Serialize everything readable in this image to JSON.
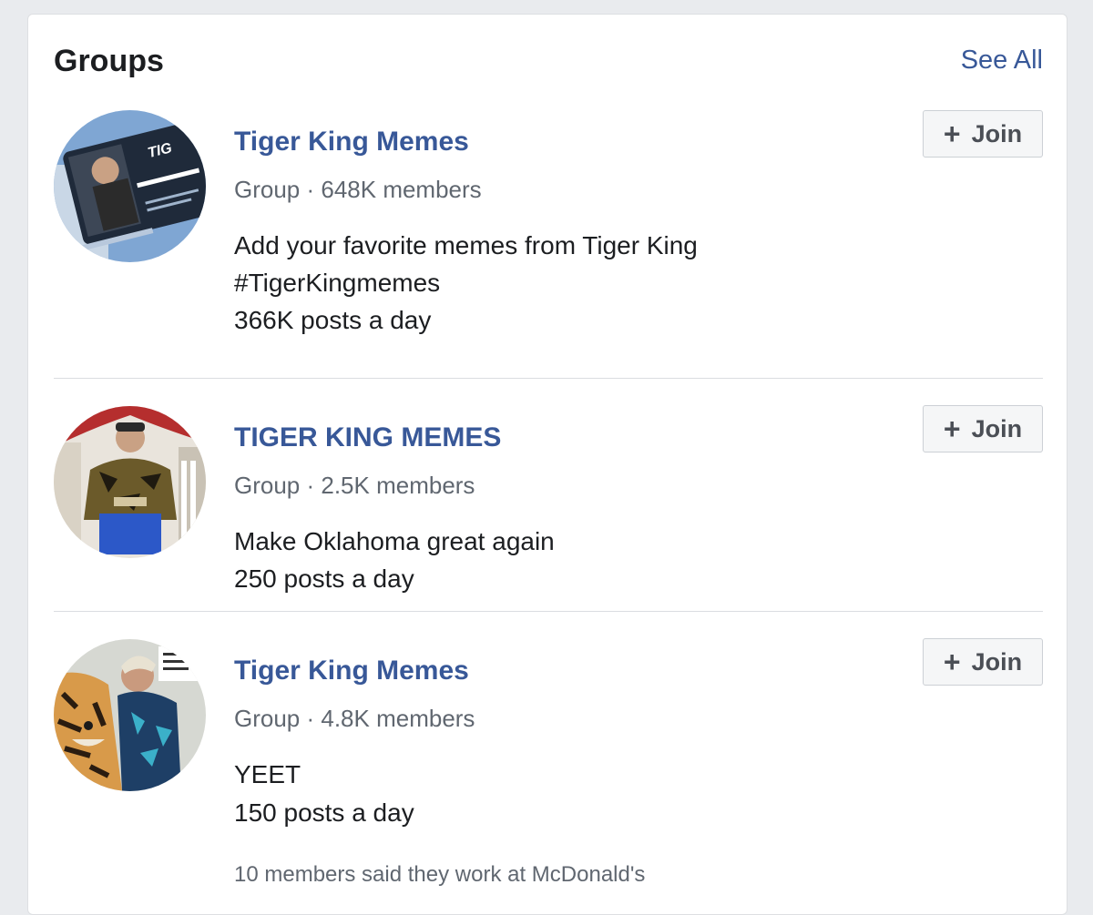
{
  "header": {
    "title": "Groups",
    "see_all": "See All"
  },
  "groups": [
    {
      "name": "Tiger King Memes",
      "meta": "Group · 648K members",
      "description": [
        "Add your favorite memes from Tiger King",
        "#TigerKingmemes"
      ],
      "activity": "366K posts a day",
      "join_label": "Join",
      "join_icon": "+"
    },
    {
      "name": "TIGER KING MEMES",
      "meta": "Group · 2.5K members",
      "description": [
        "Make Oklahoma great again"
      ],
      "activity": "250 posts a day",
      "join_label": "Join",
      "join_icon": "+"
    },
    {
      "name": "Tiger King Memes",
      "meta": "Group · 4.8K members",
      "description": [
        "YEET"
      ],
      "activity": "150 posts a day",
      "mutual": "10 members said they work at McDonald's",
      "join_label": "Join",
      "join_icon": "+"
    }
  ],
  "colors": {
    "link": "#385898",
    "text": "#1c1e21",
    "secondary": "#606770",
    "button_bg": "#f5f6f7"
  }
}
